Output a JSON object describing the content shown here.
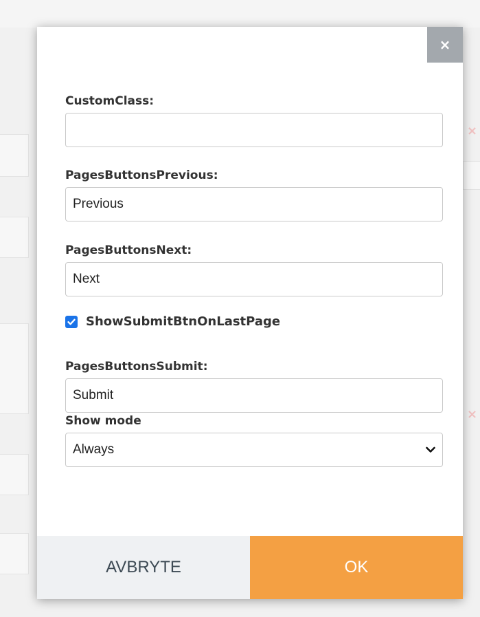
{
  "dialog": {
    "close_symbol": "×",
    "fields": {
      "custom_class": {
        "label": "CustomClass:",
        "value": ""
      },
      "pages_buttons_previous": {
        "label": "PagesButtonsPrevious:",
        "value": "Previous"
      },
      "pages_buttons_next": {
        "label": "PagesButtonsNext:",
        "value": "Next"
      },
      "show_submit": {
        "label": "ShowSubmitBtnOnLastPage",
        "checked": true
      },
      "pages_buttons_submit": {
        "label": "PagesButtonsSubmit:",
        "value": "Submit"
      },
      "show_mode": {
        "label": "Show mode",
        "selected": "Always"
      }
    },
    "footer": {
      "cancel_label": "AVBRYTE",
      "ok_label": "OK"
    }
  },
  "colors": {
    "ok_accent": "#f4a043",
    "checkbox_accent": "#1a73e8",
    "close_button": "#a3a8ad"
  }
}
